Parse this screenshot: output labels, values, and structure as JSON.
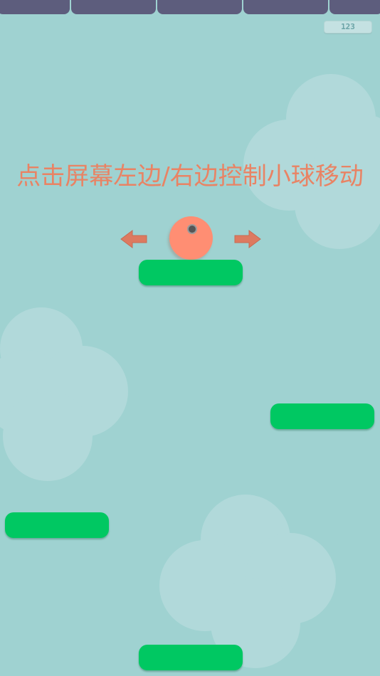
{
  "game": {
    "score": "123",
    "instruction": "点击屏幕左边/右边控制小球移动"
  },
  "colors": {
    "background": "#9fd2d1",
    "ceiling": "#5d5d7d",
    "cloud": "#b1d9da",
    "platform": "#00c862",
    "ball": "#ff8e73",
    "instruction_text": "#e98364",
    "arrow": "#dd7a60"
  },
  "icons": {
    "left_arrow": "arrow-left-icon",
    "right_arrow": "arrow-right-icon"
  }
}
